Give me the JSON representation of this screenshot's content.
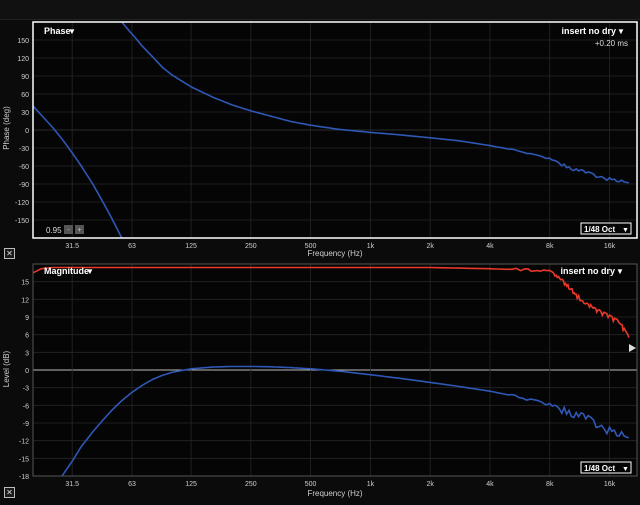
{
  "phase": {
    "title": "Phase",
    "dropdown_arrow": "▼",
    "measurement_label": "insert no dry",
    "delay": "+0.20 ms",
    "ylabel": "Phase (deg)",
    "xlabel": "Frequency (Hz)",
    "yticks": [
      "150",
      "120",
      "90",
      "60",
      "30",
      "0",
      "-30",
      "-60",
      "-90",
      "-120",
      "-150"
    ],
    "xticks": [
      "31.5",
      "63",
      "125",
      "250",
      "500",
      "1k",
      "2k",
      "4k",
      "8k",
      "16k"
    ],
    "smoothing": "1/48 Oct",
    "coherence_value": "0.95",
    "stepper_down": "-",
    "stepper_up": "+"
  },
  "magnitude": {
    "title": "Magnitude",
    "dropdown_arrow": "▼",
    "measurement_label": "insert no dry",
    "ylabel": "Level (dB)",
    "xlabel": "Frequency (Hz)",
    "yticks": [
      "15",
      "12",
      "9",
      "6",
      "3",
      "0",
      "-3",
      "-6",
      "-9",
      "-12",
      "-15",
      "-18"
    ],
    "xticks": [
      "31.5",
      "63",
      "125",
      "250",
      "500",
      "1k",
      "2k",
      "4k",
      "8k",
      "16k"
    ],
    "smoothing": "1/48 Oct"
  },
  "colors": {
    "background": "#0b0b0b",
    "plot_bg": "#050505",
    "grid": "#262626",
    "trace_blue": "#2f57b5",
    "trace_red": "#e8392a",
    "border": "#ffffff"
  },
  "icons": {
    "close": "close-icon"
  },
  "chart_data": [
    {
      "type": "line",
      "title": "Phase",
      "xlabel": "Frequency (Hz)",
      "ylabel": "Phase (deg)",
      "xscale": "log",
      "xlim": [
        20,
        22000
      ],
      "ylim": [
        -180,
        180
      ],
      "grid": true,
      "series": [
        {
          "name": "",
          "color": "#2f57b5",
          "x": [
            20,
            22,
            25,
            28,
            31.5,
            35,
            40,
            45,
            50,
            56
          ],
          "y": [
            40,
            25,
            5,
            -15,
            -38,
            -60,
            -90,
            -120,
            -148,
            -180
          ]
        },
        {
          "name": "insert no dry",
          "color": "#2f57b5",
          "x": [
            56,
            60,
            65,
            70,
            80,
            90,
            100,
            125,
            160,
            200,
            250,
            315,
            400,
            500,
            700,
            1000,
            1400,
            2000,
            2800,
            4000,
            5600,
            8000,
            10000,
            12500,
            16000,
            20000
          ],
          "y": [
            180,
            168,
            155,
            142,
            122,
            104,
            92,
            72,
            55,
            42,
            32,
            23,
            14,
            8,
            1,
            -4,
            -8,
            -13,
            -18,
            -26,
            -35,
            -48,
            -62,
            -73,
            -82,
            -88
          ]
        }
      ]
    },
    {
      "type": "line",
      "title": "Magnitude",
      "xlabel": "Frequency (Hz)",
      "ylabel": "Level (dB)",
      "xscale": "log",
      "xlim": [
        20,
        22000
      ],
      "ylim": [
        -18,
        18
      ],
      "grid": true,
      "series": [
        {
          "name": "",
          "color": "#e8392a",
          "x": [
            20,
            22,
            25,
            31.5,
            63,
            125,
            250,
            500,
            1000,
            2000,
            4000,
            6000,
            8000,
            9000,
            10000,
            11000,
            12500,
            14000,
            16000,
            18000,
            20000
          ],
          "y": [
            16.5,
            17.2,
            17.4,
            17.4,
            17.4,
            17.4,
            17.4,
            17.4,
            17.4,
            17.4,
            17.2,
            17.0,
            16.8,
            15.5,
            14.0,
            12.5,
            11.0,
            10.0,
            9.0,
            8.0,
            5.5
          ]
        },
        {
          "name": "insert no dry",
          "color": "#2f57b5",
          "x": [
            28,
            31.5,
            35,
            40,
            45,
            50,
            56,
            63,
            71,
            80,
            90,
            100,
            125,
            160,
            200,
            250,
            315,
            400,
            500,
            700,
            1000,
            1400,
            2000,
            2800,
            4000,
            5600,
            8000,
            10000,
            12500,
            16000,
            20000
          ],
          "y": [
            -18,
            -15.5,
            -13,
            -10.5,
            -8.5,
            -6.8,
            -5.2,
            -3.8,
            -2.6,
            -1.6,
            -0.9,
            -0.4,
            0.2,
            0.5,
            0.6,
            0.6,
            0.55,
            0.4,
            0.2,
            -0.2,
            -0.8,
            -1.4,
            -2.1,
            -2.8,
            -3.6,
            -4.6,
            -5.9,
            -7.0,
            -8.5,
            -10.3,
            -11.5
          ]
        }
      ]
    }
  ]
}
